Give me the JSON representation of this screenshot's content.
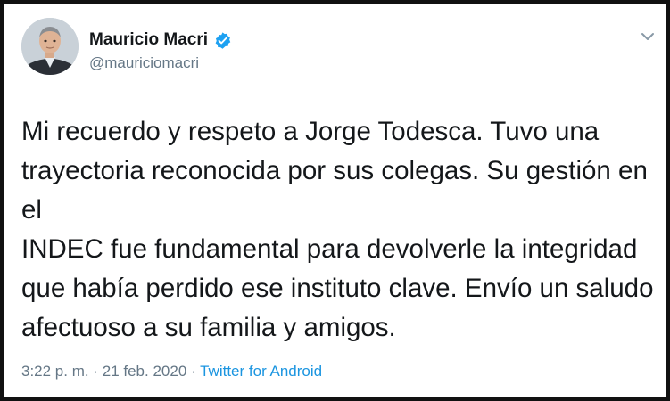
{
  "tweet": {
    "author": {
      "display_name": "Mauricio Macri",
      "handle": "@mauriciomacri",
      "verified": true,
      "avatar_icon": "profile-photo"
    },
    "body_lines": [
      "Mi recuerdo y respeto a Jorge Todesca. Tuvo una",
      "trayectoria reconocida por sus colegas. Su gestión en el",
      "INDEC fue fundamental para devolverle la integridad",
      "que había perdido ese instituto clave. Envío un saludo",
      "afectuoso a su familia y amigos."
    ],
    "time": "3:22 p. m.",
    "separator": "·",
    "date": "21 feb. 2020",
    "source": "Twitter for Android",
    "menu_icon": "chevron-down-icon"
  },
  "colors": {
    "text": "#14171a",
    "secondary": "#657786",
    "link": "#1b95e0",
    "verified_badge": "#1da1f2",
    "frame_border": "#111111"
  }
}
